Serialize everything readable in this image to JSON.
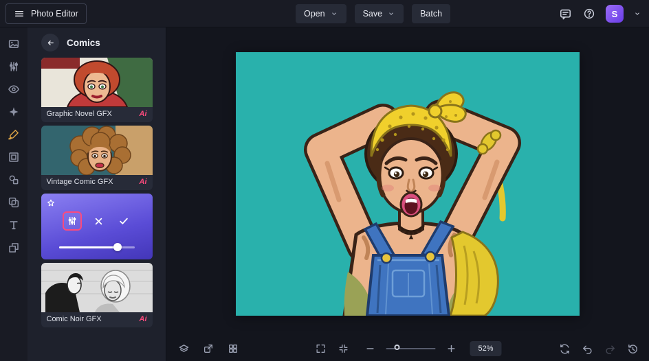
{
  "app": {
    "title": "Photo Editor"
  },
  "topbar": {
    "open": "Open",
    "save": "Save",
    "batch": "Batch",
    "avatar_initial": "S"
  },
  "rail_tools": [
    "library",
    "edit",
    "touch-up",
    "effects",
    "artsy",
    "frames",
    "graphics",
    "overlays",
    "text",
    "textures"
  ],
  "rail_active_tool": "artsy",
  "panel": {
    "title": "Comics",
    "cards": [
      {
        "label": "Graphic Novel GFX",
        "badge": "Ai"
      },
      {
        "label": "Vintage Comic GFX",
        "badge": "Ai"
      },
      {
        "label": "Comic Noir GFX",
        "badge": "Ai"
      }
    ],
    "active_effect": {
      "slider_percent": 78
    }
  },
  "statusbar": {
    "zoom": "52%",
    "zoom_slider_percent": 17
  },
  "colors": {
    "accent_pink": "#fc4a7d",
    "active_tool_gold": "#dba345",
    "selected_gradient_top": "#8b80f2",
    "selected_gradient_bottom": "#4336b8",
    "avatar_purple": "#7b52ee",
    "canvas_teal": "#29b1ac",
    "topbar_bg": "#191b24",
    "panel_bg": "#1e212c",
    "canvas_bg": "#13151d"
  },
  "icons": {
    "topbar": [
      "hamburger-icon",
      "chevron-down-icon",
      "feedback-icon",
      "help-icon"
    ],
    "rail": [
      "image-icon",
      "adjust-sliders-icon",
      "eye-icon",
      "sparkle-icon",
      "paintbrush-icon",
      "frame-icon",
      "shapes-icon",
      "overlays-icon",
      "text-icon",
      "textures-icon"
    ],
    "panel": [
      "back-arrow-icon",
      "star-icon",
      "settings-sliders-icon",
      "close-icon",
      "check-icon"
    ],
    "statusbar": [
      "layers-icon",
      "export-icon",
      "grid-icon",
      "fit-screen-icon",
      "actual-size-icon",
      "zoom-out-icon",
      "zoom-in-icon",
      "compare-icon",
      "undo-icon",
      "redo-icon",
      "history-icon"
    ]
  }
}
